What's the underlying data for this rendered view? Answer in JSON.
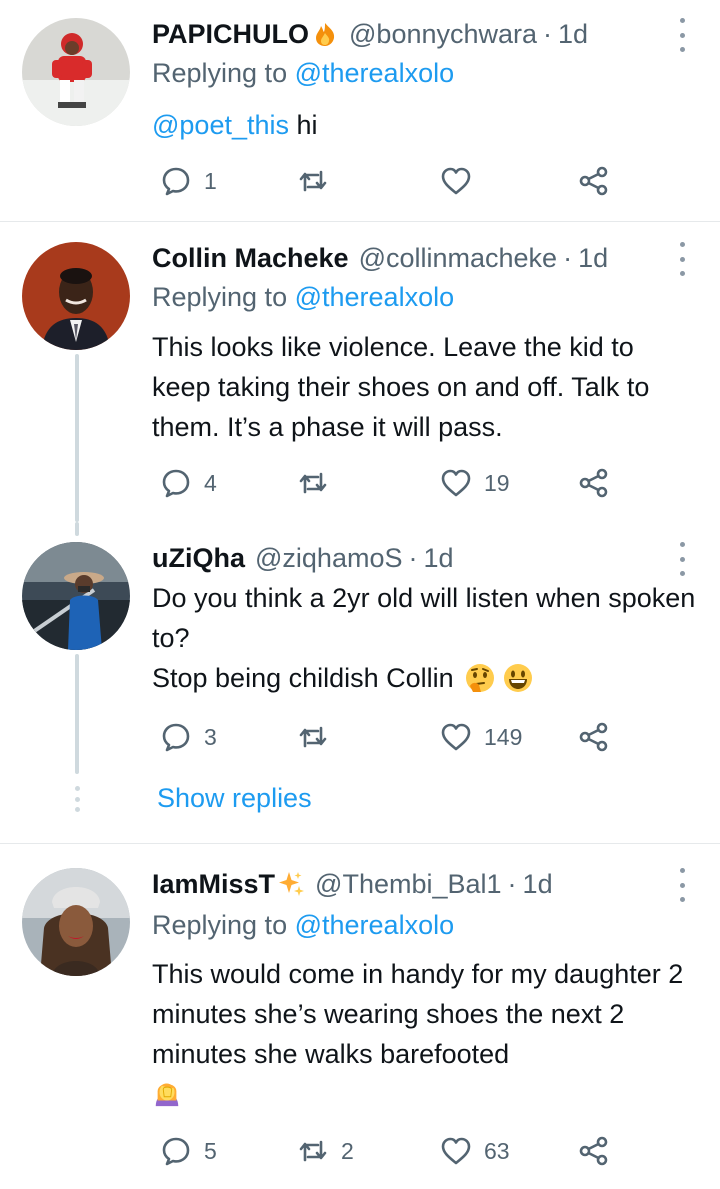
{
  "tweets": [
    {
      "name": "PAPICHULO",
      "name_emoji": "fire-emoji",
      "handle": "@bonnychwara",
      "time": "1d",
      "replying_prefix": "Replying to",
      "replying_to": "@therealxolo",
      "text_mention": "@poet_this",
      "text": " hi",
      "replies": "1",
      "retweets": "",
      "likes": ""
    },
    {
      "name": "Collin Macheke",
      "handle": "@collinmacheke",
      "time": "1d",
      "replying_prefix": "Replying to",
      "replying_to": "@therealxolo",
      "text": "This looks like violence. Leave the kid to keep taking their shoes on and off. Talk to them. It’s a phase it will pass.",
      "replies": "4",
      "retweets": "",
      "likes": "19"
    },
    {
      "name": "uZiQha",
      "handle": "@ziqhamoS",
      "time": "1d",
      "text_line1": "Do you think a 2yr old will listen when spoken to?",
      "text_line2": "Stop being childish Collin",
      "text_emojis": [
        "thinking-face-emoji",
        "grinning-face-emoji"
      ],
      "replies": "3",
      "retweets": "",
      "likes": "149"
    },
    {
      "name": "IamMissT",
      "name_emoji": "sparkles-emoji",
      "handle": "@Thembi_Bal1",
      "time": "1d",
      "replying_prefix": "Replying to",
      "replying_to": "@therealxolo",
      "text": "This would come in handy for my daughter 2 minutes she’s wearing shoes the next 2 minutes she walks barefooted",
      "text_emoji": "woman-facepalming-emoji",
      "replies": "5",
      "retweets": "2",
      "likes": "63"
    }
  ],
  "show_replies_label": "Show replies",
  "dot_separator": "·",
  "colors": {
    "accent": "#1d9bf0",
    "secondary_text": "#536471",
    "primary_text": "#0f1419",
    "divider": "#e6e9eb",
    "thread_line": "#cfd9de"
  }
}
